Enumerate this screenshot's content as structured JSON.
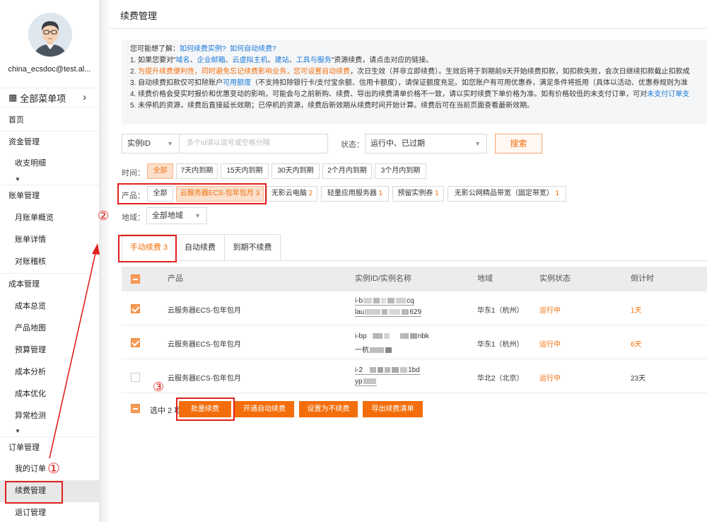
{
  "user": {
    "email": "china_ecsdoc@test.al..."
  },
  "sidebar": {
    "all_menu": "全部菜单项",
    "items": [
      {
        "label": "首页"
      },
      {
        "label": "资金管理"
      },
      {
        "label": "收支明细"
      },
      {
        "label": "账单管理"
      },
      {
        "label": "月账单概览"
      },
      {
        "label": "账单详情"
      },
      {
        "label": "对账稽核"
      },
      {
        "label": "成本管理"
      },
      {
        "label": "成本总览"
      },
      {
        "label": "产品地图"
      },
      {
        "label": "预算管理"
      },
      {
        "label": "成本分析"
      },
      {
        "label": "成本优化"
      },
      {
        "label": "异常检测"
      },
      {
        "label": "订单管理"
      },
      {
        "label": "我的订单"
      },
      {
        "label": "续费管理"
      },
      {
        "label": "退订管理"
      }
    ]
  },
  "page": {
    "title": "续费管理"
  },
  "notice": {
    "intro": "您可能想了解：",
    "link1": "如何续费实例?",
    "link2": "如何自动续费?",
    "l1_a": "1. 如果您要对\"",
    "l1_l1": "域名",
    "l1_s1": "、",
    "l1_l2": "企业邮箱",
    "l1_s2": "、",
    "l1_l3": "云虚拟主机",
    "l1_s3": "、",
    "l1_l4": "建站",
    "l1_s4": "、",
    "l1_l5": "工具与服务",
    "l1_b": "\"资源续费，请点击对应的链接。",
    "l2_a": "2. ",
    "l2_hl": "为提升续费便利性，同时避免忘记续费影响业务，您可设置自动续费",
    "l2_b": "，次日生效（并非立即续费）。生效后将于到期前9天开始续费扣款，如扣款失败，会次日继续扣款截止扣款成",
    "l3_a": "3. 自动续费扣款仅可扣除账户",
    "l3_link": "可用额度",
    "l3_b": "（不支持扣除银行卡/支付宝余额、信用卡额度），请保证额度充足。如您账户有可用优惠券，满足条件将抵用（具体以活动、优惠券规则为准",
    "l4_a": "4. 续费价格会受实时报价和优惠变动的影响，可能会与之前新购、续费、导出的续费清单价格不一致，请以实时续费下单价格为准。如有价格较低的未支付订单，可对",
    "l4_link": "未支付订单支",
    "l5": "5. 未停机的资源，续费后直接延长效期；已停机的资源，续费后新效期从续费时间开始计算。续费后可在当前页面查看最新效期。"
  },
  "filters": {
    "id_select": "实例ID",
    "id_placeholder": "多个id请以逗号或空格分隔",
    "status_label": "状态：",
    "status_value": "运行中、已过期",
    "search_button": "搜索",
    "time_label": "时间：",
    "time_options": [
      "全部",
      "7天内到期",
      "15天内到期",
      "30天内到期",
      "2个月内到期",
      "3个月内到期"
    ],
    "product_label": "产品：",
    "product_options": [
      {
        "name": "全部",
        "count": ""
      },
      {
        "name": "云服务器ECS-包年包月",
        "count": "3"
      },
      {
        "name": "无影云电脑",
        "count": "2"
      },
      {
        "name": "轻量应用服务器",
        "count": "1"
      },
      {
        "name": "预留实例券",
        "count": "1"
      },
      {
        "name": "无影公网精品带宽（固定带宽）",
        "count": "1"
      }
    ],
    "region_label": "地域：",
    "region_value": "全部地域"
  },
  "tabs": [
    {
      "label": "手动续费",
      "count": "3"
    },
    {
      "label": "自动续费",
      "count": ""
    },
    {
      "label": "到期不续费",
      "count": ""
    }
  ],
  "table": {
    "headers": [
      "产品",
      "实例ID/实例名称",
      "地域",
      "实例状态",
      "倒计时"
    ],
    "rows": [
      {
        "product": "云服务器ECS-包年包月",
        "id1_a": "i-b",
        "id1_b": "cq",
        "id2_a": "lau",
        "id2_b": "629",
        "region": "华东1（杭州）",
        "status": "运行中",
        "countdown": "1天"
      },
      {
        "product": "云服务器ECS-包年包月",
        "id1_a": "i-bp",
        "id1_b": "nbk",
        "id2_a": "一杭",
        "id2_b": "",
        "region": "华东1（杭州）",
        "status": "运行中",
        "countdown": "6天"
      },
      {
        "product": "云服务器ECS-包年包月",
        "id1_a": "i-2",
        "id1_b": "1bd",
        "id2_a": "yp",
        "id2_b": "",
        "region": "华北2（北京）",
        "status": "运行中",
        "countdown": "23天"
      }
    ]
  },
  "footer": {
    "selected": "选中 2 项",
    "buttons": [
      "批量续费",
      "开通自动续费",
      "设置为不续费",
      "导出续费清单"
    ]
  },
  "annotations": {
    "a1": "①",
    "a2": "②",
    "a3": "③"
  },
  "colors": {
    "accent": "#f36e0b",
    "link": "#1a7adb",
    "annotation": "#e0201e"
  }
}
